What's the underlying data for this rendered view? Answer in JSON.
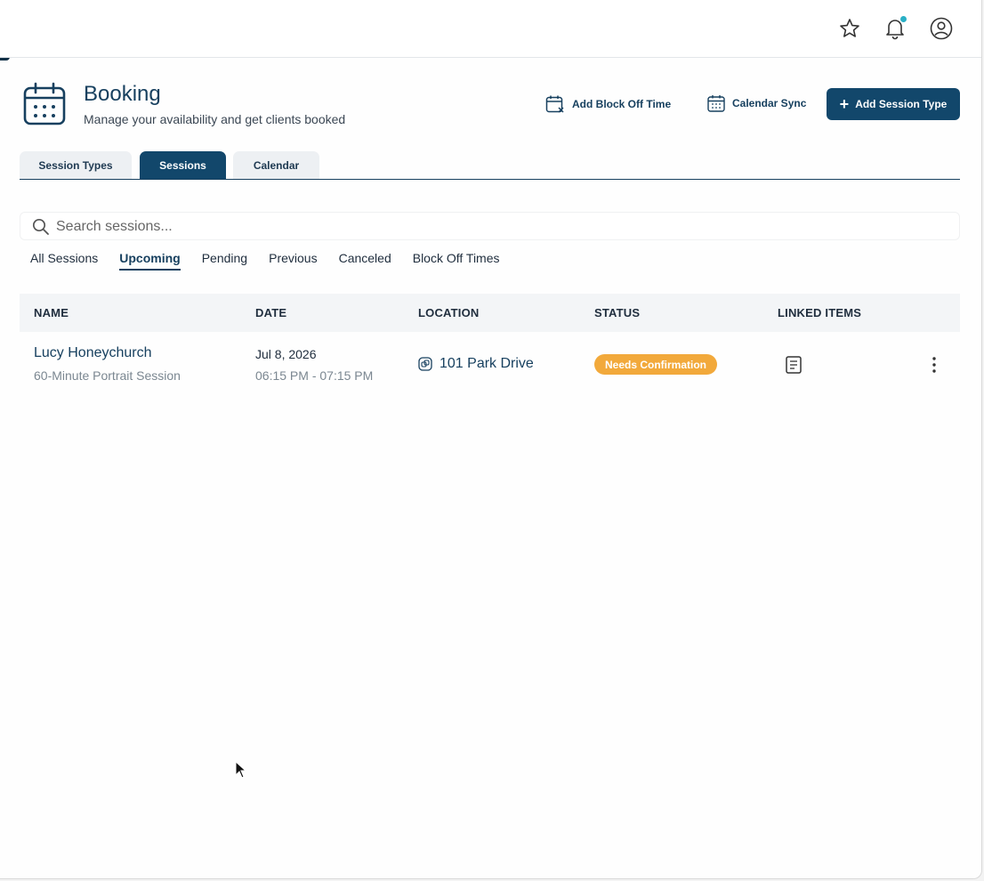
{
  "header": {
    "title": "Booking",
    "subtitle": "Manage your availability and get clients booked"
  },
  "actions": {
    "block_off": "Add Block Off Time",
    "calendar_sync": "Calendar Sync",
    "add_session_type": "Add Session Type"
  },
  "tabs": [
    {
      "label": "Session Types",
      "active": false
    },
    {
      "label": "Sessions",
      "active": true
    },
    {
      "label": "Calendar",
      "active": false
    }
  ],
  "search": {
    "placeholder": "Search sessions..."
  },
  "filters": [
    {
      "label": "All Sessions",
      "active": false
    },
    {
      "label": "Upcoming",
      "active": true
    },
    {
      "label": "Pending",
      "active": false
    },
    {
      "label": "Previous",
      "active": false
    },
    {
      "label": "Canceled",
      "active": false
    },
    {
      "label": "Block Off Times",
      "active": false
    }
  ],
  "table": {
    "columns": [
      "NAME",
      "DATE",
      "LOCATION",
      "STATUS",
      "LINKED ITEMS"
    ],
    "rows": [
      {
        "client": "Lucy Honeychurch",
        "session_type": "60-Minute Portrait Session",
        "date": "Jul 8, 2026",
        "time": "06:15 PM - 07:15 PM",
        "location": "101 Park Drive",
        "status": "Needs Confirmation"
      }
    ]
  },
  "colors": {
    "primary": "#12476b",
    "status_pending": "#f2a93b",
    "notification_dot": "#2ab0c6"
  },
  "icons": {
    "favorite": "star-icon",
    "notifications": "bell-icon",
    "account": "user-circle-icon",
    "page": "calendar-icon",
    "block_off": "calendar-x-icon",
    "calendar_sync": "calendar-icon",
    "search": "search-icon",
    "location": "link-icon",
    "linked": "document-icon",
    "row_menu": "kebab-menu-icon"
  }
}
